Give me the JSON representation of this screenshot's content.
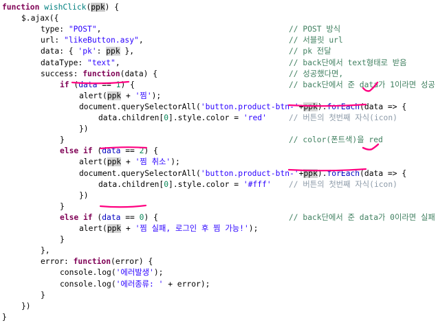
{
  "colors": {
    "keyword": "#7f0055",
    "function_name": "#008080",
    "string": "#2a00ff",
    "property": "#0000c0",
    "variable": "#000000",
    "number": "#098658",
    "comment": "#3f7f5f",
    "comment_faded": "#8c9aa8",
    "selection_highlight": "#d4d4d4",
    "annotation": "#ff0080"
  },
  "lines": [
    {
      "indent": 0,
      "tokens": [
        {
          "t": "function ",
          "c": "keyword"
        },
        {
          "t": "wishClick",
          "c": "function_name"
        },
        {
          "t": "(",
          "c": "variable"
        },
        {
          "t": "ppk",
          "c": "variable",
          "hl": "sel"
        },
        {
          "t": ") {",
          "c": "variable"
        }
      ],
      "comment": ""
    },
    {
      "indent": 1,
      "tokens": [
        {
          "t": "$.ajax({",
          "c": "variable"
        }
      ],
      "comment": ""
    },
    {
      "indent": 2,
      "tokens": [
        {
          "t": "type: ",
          "c": "variable"
        },
        {
          "t": "\"POST\"",
          "c": "string"
        },
        {
          "t": ",",
          "c": "variable"
        }
      ],
      "comment": "// POST 방식"
    },
    {
      "indent": 2,
      "tokens": [
        {
          "t": "url: ",
          "c": "variable"
        },
        {
          "t": "\"likeButton.asy\"",
          "c": "string"
        },
        {
          "t": ",",
          "c": "variable"
        }
      ],
      "comment": "// 서블릿 url"
    },
    {
      "indent": 2,
      "tokens": [
        {
          "t": "data: { ",
          "c": "variable"
        },
        {
          "t": "'pk'",
          "c": "string"
        },
        {
          "t": ": ",
          "c": "variable"
        },
        {
          "t": "ppk",
          "c": "variable",
          "hl": "ref"
        },
        {
          "t": " },",
          "c": "variable"
        }
      ],
      "comment": "// pk 전달"
    },
    {
      "indent": 2,
      "tokens": [
        {
          "t": "dataType: ",
          "c": "variable"
        },
        {
          "t": "\"text\"",
          "c": "string"
        },
        {
          "t": ",",
          "c": "variable"
        }
      ],
      "comment": "// back단에서 text형태로 받음"
    },
    {
      "indent": 2,
      "tokens": [
        {
          "t": "success: ",
          "c": "variable"
        },
        {
          "t": "function",
          "c": "keyword"
        },
        {
          "t": "(data) {",
          "c": "variable"
        }
      ],
      "comment": "// 성공했다면,"
    },
    {
      "indent": 3,
      "tokens": [
        {
          "t": "if",
          "c": "keyword"
        },
        {
          "t": " (",
          "c": "variable"
        },
        {
          "t": "data",
          "c": "property"
        },
        {
          "t": " == ",
          "c": "variable"
        },
        {
          "t": "1",
          "c": "number"
        },
        {
          "t": ") {",
          "c": "variable"
        }
      ],
      "comment": "// back단에서 준 data가 1이라면 성공"
    },
    {
      "indent": 4,
      "tokens": [
        {
          "t": "alert(",
          "c": "variable"
        },
        {
          "t": "ppk",
          "c": "variable",
          "hl": "ref"
        },
        {
          "t": " + ",
          "c": "variable"
        },
        {
          "t": "'찜'",
          "c": "string"
        },
        {
          "t": ");",
          "c": "variable"
        }
      ],
      "comment": ""
    },
    {
      "indent": 4,
      "tokens": [
        {
          "t": "document.querySelectorAll(",
          "c": "variable"
        },
        {
          "t": "'button.product-btn-'",
          "c": "string"
        },
        {
          "t": "+",
          "c": "variable"
        },
        {
          "t": "ppk",
          "c": "variable",
          "hl": "ref"
        },
        {
          "t": ").",
          "c": "variable"
        },
        {
          "t": "forEach",
          "c": "property"
        },
        {
          "t": "(data => {",
          "c": "variable"
        }
      ],
      "comment": ""
    },
    {
      "indent": 5,
      "tokens": [
        {
          "t": "data.children[",
          "c": "variable"
        },
        {
          "t": "0",
          "c": "number"
        },
        {
          "t": "].style.color = ",
          "c": "variable"
        },
        {
          "t": "'red'",
          "c": "string"
        }
      ],
      "comment": "// 버튼의 첫번째 자식(icon)",
      "faded": true
    },
    {
      "indent": 4,
      "tokens": [
        {
          "t": "})",
          "c": "variable"
        }
      ],
      "comment": ""
    },
    {
      "indent": 3,
      "tokens": [
        {
          "t": "}",
          "c": "variable"
        }
      ],
      "comment": "// color(폰트색)을 red"
    },
    {
      "indent": 3,
      "tokens": [
        {
          "t": "else if",
          "c": "keyword"
        },
        {
          "t": " (",
          "c": "variable"
        },
        {
          "t": "data",
          "c": "property"
        },
        {
          "t": " == ",
          "c": "variable"
        },
        {
          "t": "2",
          "c": "number"
        },
        {
          "t": ") {",
          "c": "variable"
        }
      ],
      "comment": ""
    },
    {
      "indent": 4,
      "tokens": [
        {
          "t": "alert(",
          "c": "variable"
        },
        {
          "t": "ppk",
          "c": "variable",
          "hl": "ref"
        },
        {
          "t": " + ",
          "c": "variable"
        },
        {
          "t": "'찜 취소'",
          "c": "string"
        },
        {
          "t": ");",
          "c": "variable"
        }
      ],
      "comment": ""
    },
    {
      "indent": 4,
      "tokens": [
        {
          "t": "document.querySelectorAll(",
          "c": "variable"
        },
        {
          "t": "'button.product-btn-'",
          "c": "string"
        },
        {
          "t": "+",
          "c": "variable"
        },
        {
          "t": "ppk",
          "c": "variable",
          "hl": "ref"
        },
        {
          "t": ").",
          "c": "variable"
        },
        {
          "t": "forEach",
          "c": "property"
        },
        {
          "t": "(data => {",
          "c": "variable"
        }
      ],
      "comment": ""
    },
    {
      "indent": 5,
      "tokens": [
        {
          "t": "data.children[",
          "c": "variable"
        },
        {
          "t": "0",
          "c": "number"
        },
        {
          "t": "].style.color = ",
          "c": "variable"
        },
        {
          "t": "'#fff'",
          "c": "string"
        }
      ],
      "comment": "// 버튼의 첫번째 자식(icon)",
      "faded": true
    },
    {
      "indent": 4,
      "tokens": [
        {
          "t": "})",
          "c": "variable"
        }
      ],
      "comment": ""
    },
    {
      "indent": 3,
      "tokens": [
        {
          "t": "}",
          "c": "variable"
        }
      ],
      "comment": ""
    },
    {
      "indent": 3,
      "tokens": [
        {
          "t": "else if",
          "c": "keyword"
        },
        {
          "t": " (",
          "c": "variable"
        },
        {
          "t": "data",
          "c": "property"
        },
        {
          "t": " == ",
          "c": "variable"
        },
        {
          "t": "0",
          "c": "number"
        },
        {
          "t": ") {",
          "c": "variable"
        }
      ],
      "comment": "// back단에서 준 data가 0이라면 실패"
    },
    {
      "indent": 4,
      "tokens": [
        {
          "t": "alert(",
          "c": "variable"
        },
        {
          "t": "ppk",
          "c": "variable",
          "hl": "ref"
        },
        {
          "t": " + ",
          "c": "variable"
        },
        {
          "t": "'찜 실패, 로그인 후 찜 가능!'",
          "c": "string"
        },
        {
          "t": ");",
          "c": "variable"
        }
      ],
      "comment": ""
    },
    {
      "indent": 3,
      "tokens": [
        {
          "t": "}",
          "c": "variable"
        }
      ],
      "comment": ""
    },
    {
      "indent": 2,
      "tokens": [
        {
          "t": "},",
          "c": "variable"
        }
      ],
      "comment": ""
    },
    {
      "indent": 2,
      "tokens": [
        {
          "t": "error: ",
          "c": "variable"
        },
        {
          "t": "function",
          "c": "keyword"
        },
        {
          "t": "(error) {",
          "c": "variable"
        }
      ],
      "comment": ""
    },
    {
      "indent": 3,
      "tokens": [
        {
          "t": "console.log(",
          "c": "variable"
        },
        {
          "t": "'에러발생'",
          "c": "string"
        },
        {
          "t": ");",
          "c": "variable"
        }
      ],
      "comment": ""
    },
    {
      "indent": 3,
      "tokens": [
        {
          "t": "console.log(",
          "c": "variable"
        },
        {
          "t": "'에러종류: '",
          "c": "string"
        },
        {
          "t": " + error);",
          "c": "variable"
        }
      ],
      "comment": ""
    },
    {
      "indent": 2,
      "tokens": [
        {
          "t": "}",
          "c": "variable"
        }
      ],
      "comment": ""
    },
    {
      "indent": 1,
      "tokens": [
        {
          "t": "})",
          "c": "variable"
        }
      ],
      "comment": ""
    },
    {
      "indent": 0,
      "tokens": [
        {
          "t": "}",
          "c": "variable"
        }
      ],
      "comment": ""
    }
  ]
}
